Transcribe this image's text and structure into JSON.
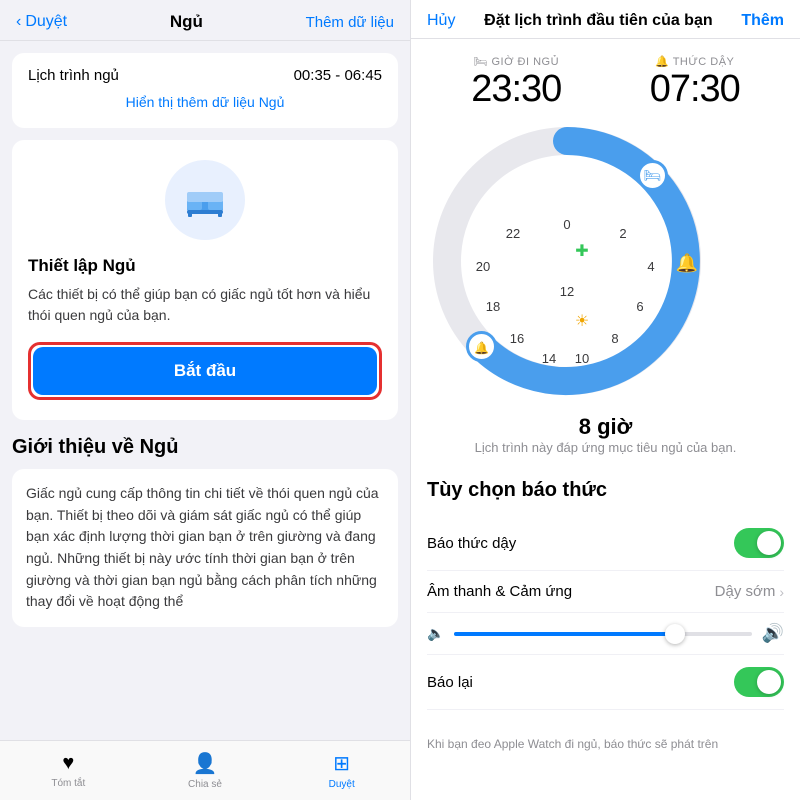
{
  "left": {
    "nav": {
      "back_label": "Duyệt",
      "title": "Ngủ",
      "add_data_label": "Thêm dữ liệu"
    },
    "schedule": {
      "label": "Lịch trình ngủ",
      "time": "00:35 - 06:45"
    },
    "show_more": "Hiển thị thêm dữ liệu Ngủ",
    "setup": {
      "title": "Thiết lập Ngủ",
      "description": "Các thiết bị có thể giúp bạn có giấc ngủ tốt hơn và hiểu thói quen ngủ của bạn.",
      "button_label": "Bắt đầu"
    },
    "intro": {
      "title": "Giới thiệu về Ngủ",
      "text": "Giấc ngủ cung cấp thông tin chi tiết về thói quen ngủ của bạn. Thiết bị theo dõi và giám sát giấc ngủ có thể giúp bạn xác định lượng thời gian bạn ở trên giường và đang ngủ. Những thiết bị này ước tính thời gian bạn ở trên giường và thời gian bạn ngủ bằng cách phân tích những thay đổi về hoạt động thể"
    },
    "tabs": [
      {
        "id": "tomtat",
        "label": "Tóm tắt",
        "icon": "♥",
        "active": false
      },
      {
        "id": "chiase",
        "label": "Chia sẻ",
        "icon": "👤",
        "active": false
      },
      {
        "id": "duyet",
        "label": "Duyệt",
        "icon": "⊞",
        "active": true
      }
    ]
  },
  "right": {
    "nav": {
      "cancel_label": "Hủy",
      "title": "Đặt lịch trình đầu tiên của bạn",
      "them_label": "Thêm"
    },
    "times": {
      "bed_label": "GIỜ ĐI NGỦ",
      "bed_icon": "🛏",
      "bed_time": "23:30",
      "wake_label": "THỨC DẬY",
      "wake_icon": "🔔",
      "wake_time": "07:30"
    },
    "clock": {
      "numbers": [
        "0",
        "2",
        "4",
        "6",
        "8",
        "10",
        "12",
        "14",
        "16",
        "18",
        "20",
        "22"
      ],
      "sleep_handle_time": "23:30",
      "wake_handle_time": "07:30"
    },
    "duration": {
      "hours": "8 giờ",
      "desc": "Lịch trình này đáp ứng mục tiêu ngủ của bạn."
    },
    "alarm_options": {
      "title": "Tùy chọn báo thức",
      "wake_alarm": {
        "label": "Báo thức dậy",
        "toggle": true
      },
      "sound": {
        "label": "Âm thanh & Cảm ứng",
        "value": "Dậy sớm"
      },
      "snooze": {
        "label": "Báo lại",
        "toggle": true
      }
    },
    "note": "Khi bạn đeo Apple Watch đi ngủ, báo thức sẽ phát trên"
  }
}
